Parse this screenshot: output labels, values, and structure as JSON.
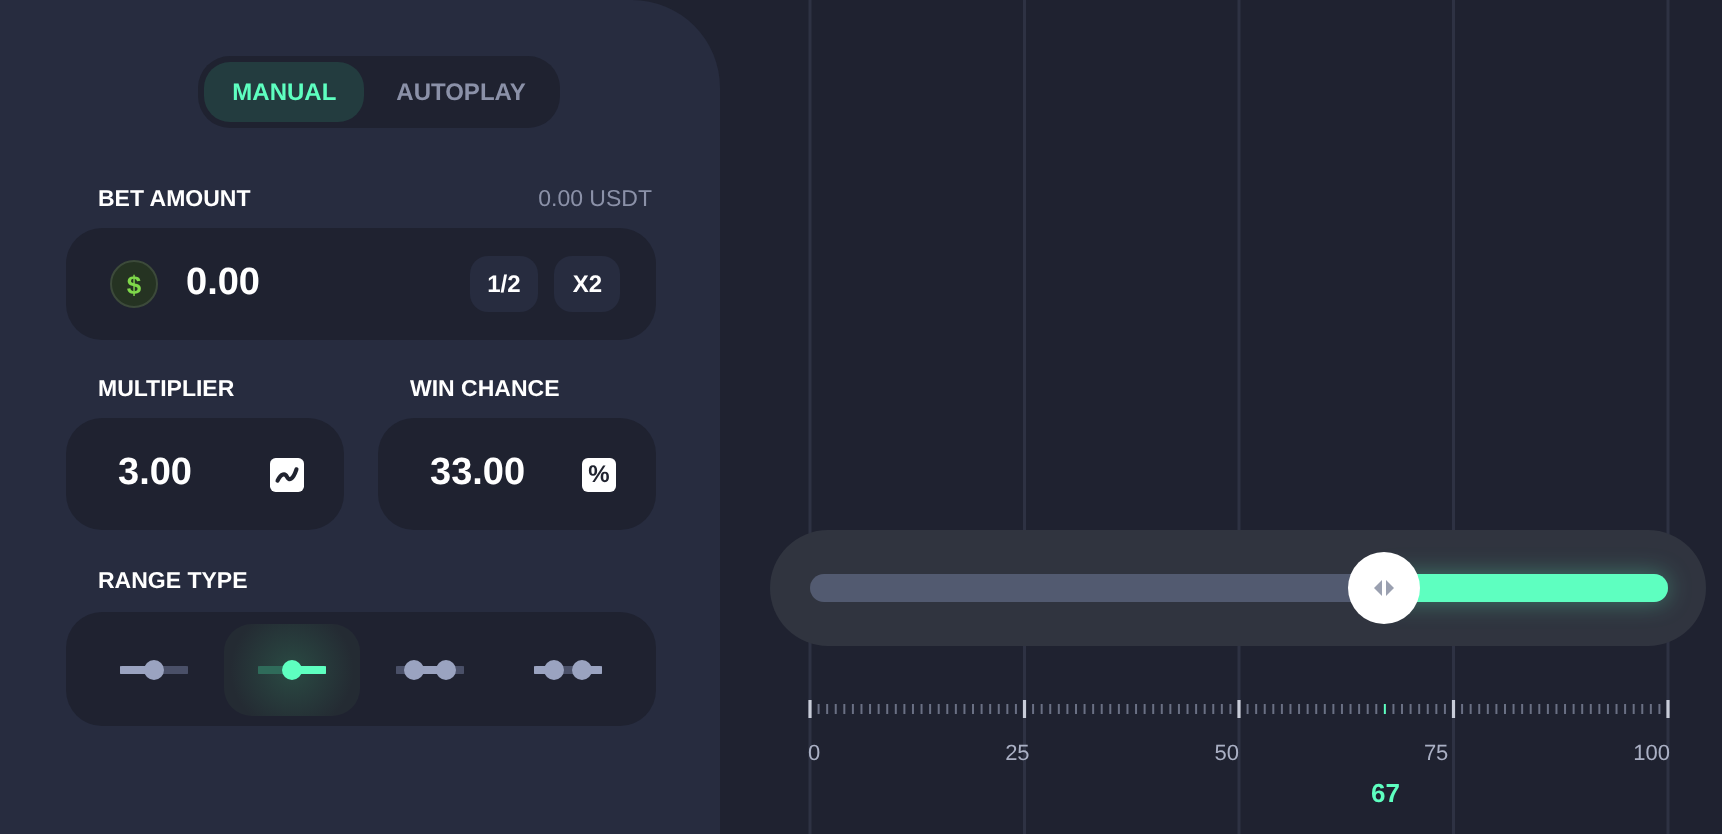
{
  "mode_tabs": [
    {
      "label": "MANUAL",
      "selected": true
    },
    {
      "label": "AUTOPLAY",
      "selected": false
    }
  ],
  "bet": {
    "label": "BET AMOUNT",
    "balance": "0.00 USDT",
    "value": "0.00",
    "currency_symbol": "$",
    "buttons": [
      "1/2",
      "X2"
    ]
  },
  "multiplier": {
    "label": "MULTIPLIER",
    "value": "3.00"
  },
  "win_chance": {
    "label": "WIN CHANCE",
    "value": "33.00",
    "unit_symbol": "%"
  },
  "range_type": {
    "label": "RANGE TYPE",
    "options": [
      {
        "kind": "under",
        "selected": false
      },
      {
        "kind": "over",
        "selected": true
      },
      {
        "kind": "inside",
        "selected": false
      },
      {
        "kind": "outside",
        "selected": false
      }
    ]
  },
  "slider": {
    "level": 0.67,
    "reading": "67",
    "tick_labels": [
      "0",
      "25",
      "50",
      "75",
      "100"
    ]
  }
}
